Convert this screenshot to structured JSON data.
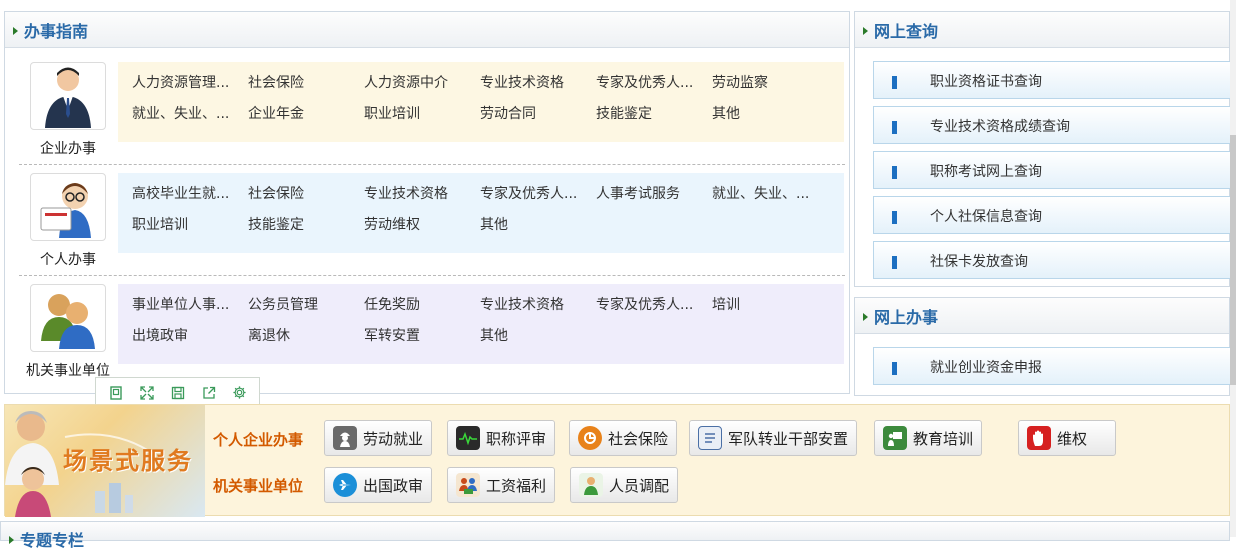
{
  "guide": {
    "title": "办事指南",
    "categories": [
      {
        "label": "企业办事",
        "icon": "business-person-icon",
        "rows": [
          [
            "人力资源管理...",
            "社会保险",
            "人力资源中介",
            "专业技术资格",
            "专家及优秀人...",
            "劳动监察"
          ],
          [
            "就业、失业、...",
            "企业年金",
            "职业培训",
            "劳动合同",
            "技能鉴定",
            "其他"
          ]
        ]
      },
      {
        "label": "个人办事",
        "icon": "person-card-icon",
        "rows": [
          [
            "高校毕业生就...",
            "社会保险",
            "专业技术资格",
            "专家及优秀人...",
            "人事考试服务",
            "就业、失业、..."
          ],
          [
            "职业培训",
            "技能鉴定",
            "劳动维权",
            "其他"
          ]
        ]
      },
      {
        "label": "机关事业单位",
        "icon": "group-people-icon",
        "rows": [
          [
            "事业单位人事...",
            "公务员管理",
            "任免奖励",
            "专业技术资格",
            "专家及优秀人...",
            "培训"
          ],
          [
            "出境政审",
            "离退休",
            "军转安置",
            "其他"
          ]
        ]
      }
    ]
  },
  "query": {
    "title": "网上查询",
    "items": [
      "职业资格证书查询",
      "专业技术资格成绩查询",
      "职称考试网上查询",
      "个人社保信息查询",
      "社保卡发放查询"
    ]
  },
  "online": {
    "title": "网上办事",
    "items": [
      "就业创业资金申报"
    ]
  },
  "toolbar": {
    "icons": [
      "screenshot-icon",
      "fullscreen-icon",
      "save-icon",
      "share-icon",
      "settings-icon"
    ]
  },
  "scene": {
    "banner": "场景式服务",
    "group1": "个人企业办事",
    "group2": "机关事业单位",
    "buttons1": [
      {
        "label": "劳动就业",
        "icon": "worker-icon",
        "color": "#555555"
      },
      {
        "label": "职称评审",
        "icon": "monitor-pulse-icon",
        "color": "#2a2a2a"
      },
      {
        "label": "社会保险",
        "icon": "insurance-icon",
        "color": "#e8821a"
      },
      {
        "label": "军队转业干部安置",
        "icon": "document-list-icon",
        "color": "#4a6fa5"
      },
      {
        "label": "教育培训",
        "icon": "teacher-board-icon",
        "color": "#3c8a3c"
      },
      {
        "label": "维权",
        "icon": "hand-stop-icon",
        "color": "#d62020"
      }
    ],
    "buttons2": [
      {
        "label": "出国政审",
        "icon": "airplane-icon",
        "color": "#1b8fd8"
      },
      {
        "label": "工资福利",
        "icon": "people-money-icon",
        "color": "#c84a1a"
      },
      {
        "label": "人员调配",
        "icon": "person-transfer-icon",
        "color": "#3c9a3c"
      }
    ]
  },
  "bottom": {
    "title": "专题专栏"
  },
  "colors": {
    "accent": "#2a6aa8",
    "sceneOrange": "#d35a00",
    "linkBlue": "#1c6fc1"
  }
}
